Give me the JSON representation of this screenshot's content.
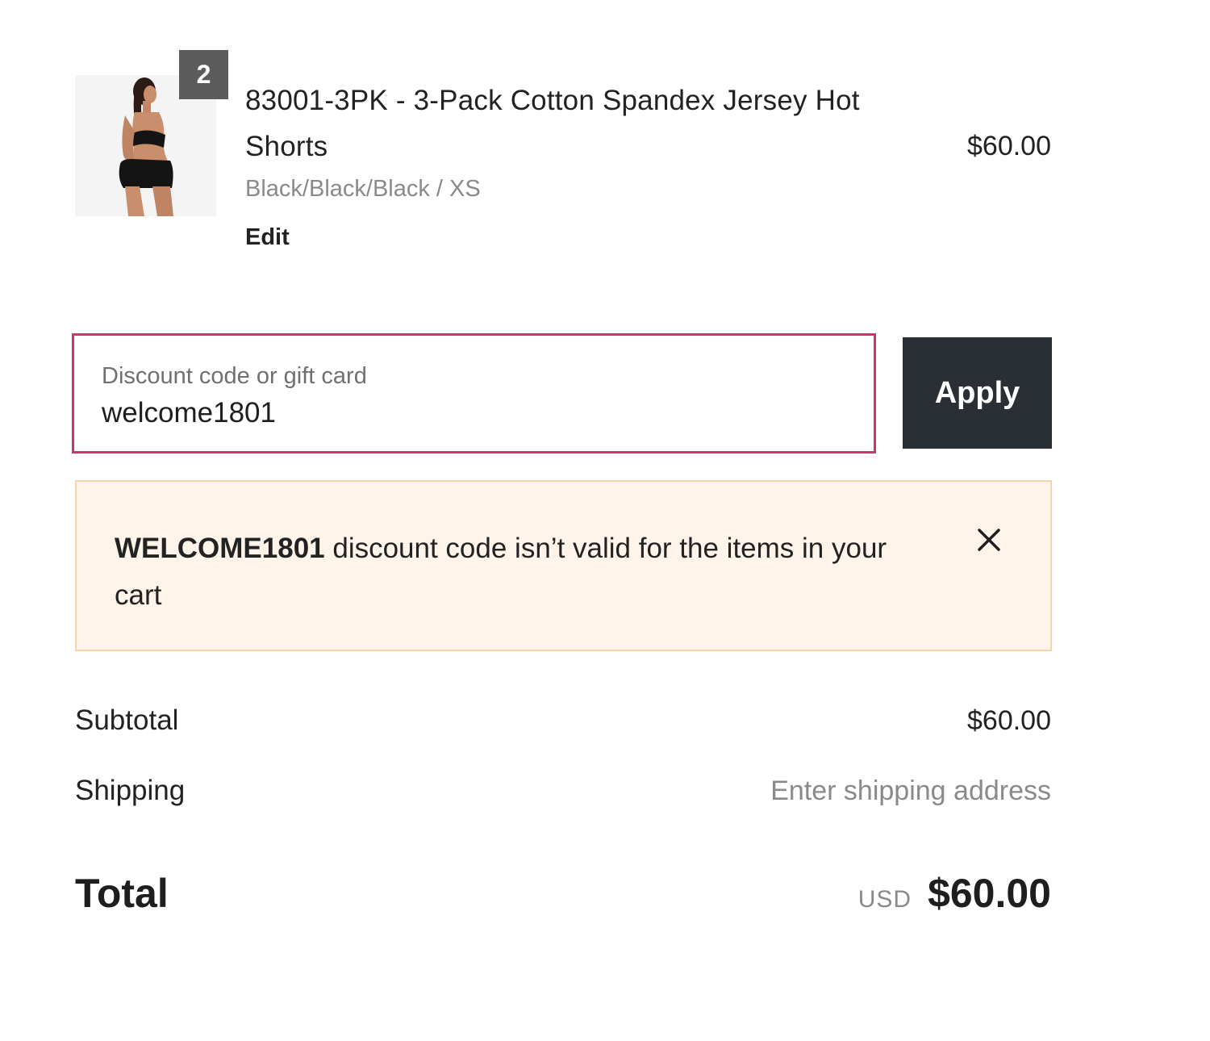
{
  "line_item": {
    "quantity": "2",
    "title": "83001-3PK - 3-Pack Cotton Spandex Jersey Hot Shorts",
    "variant": "Black/Black/Black / XS",
    "edit_label": "Edit",
    "price": "$60.00"
  },
  "discount": {
    "label": "Discount code or gift card",
    "value": "welcome1801",
    "placeholder": "Discount code or gift card",
    "apply_label": "Apply",
    "accent_color": "#d1336b"
  },
  "banner": {
    "code": "WELCOME1801",
    "message": " discount code isn’t valid for the items in your cart",
    "close_icon": "close-icon"
  },
  "totals": {
    "subtotal_label": "Subtotal",
    "subtotal_value": "$60.00",
    "shipping_label": "Shipping",
    "shipping_value": "Enter shipping address",
    "total_label": "Total",
    "currency": "USD",
    "total_value": "$60.00"
  }
}
